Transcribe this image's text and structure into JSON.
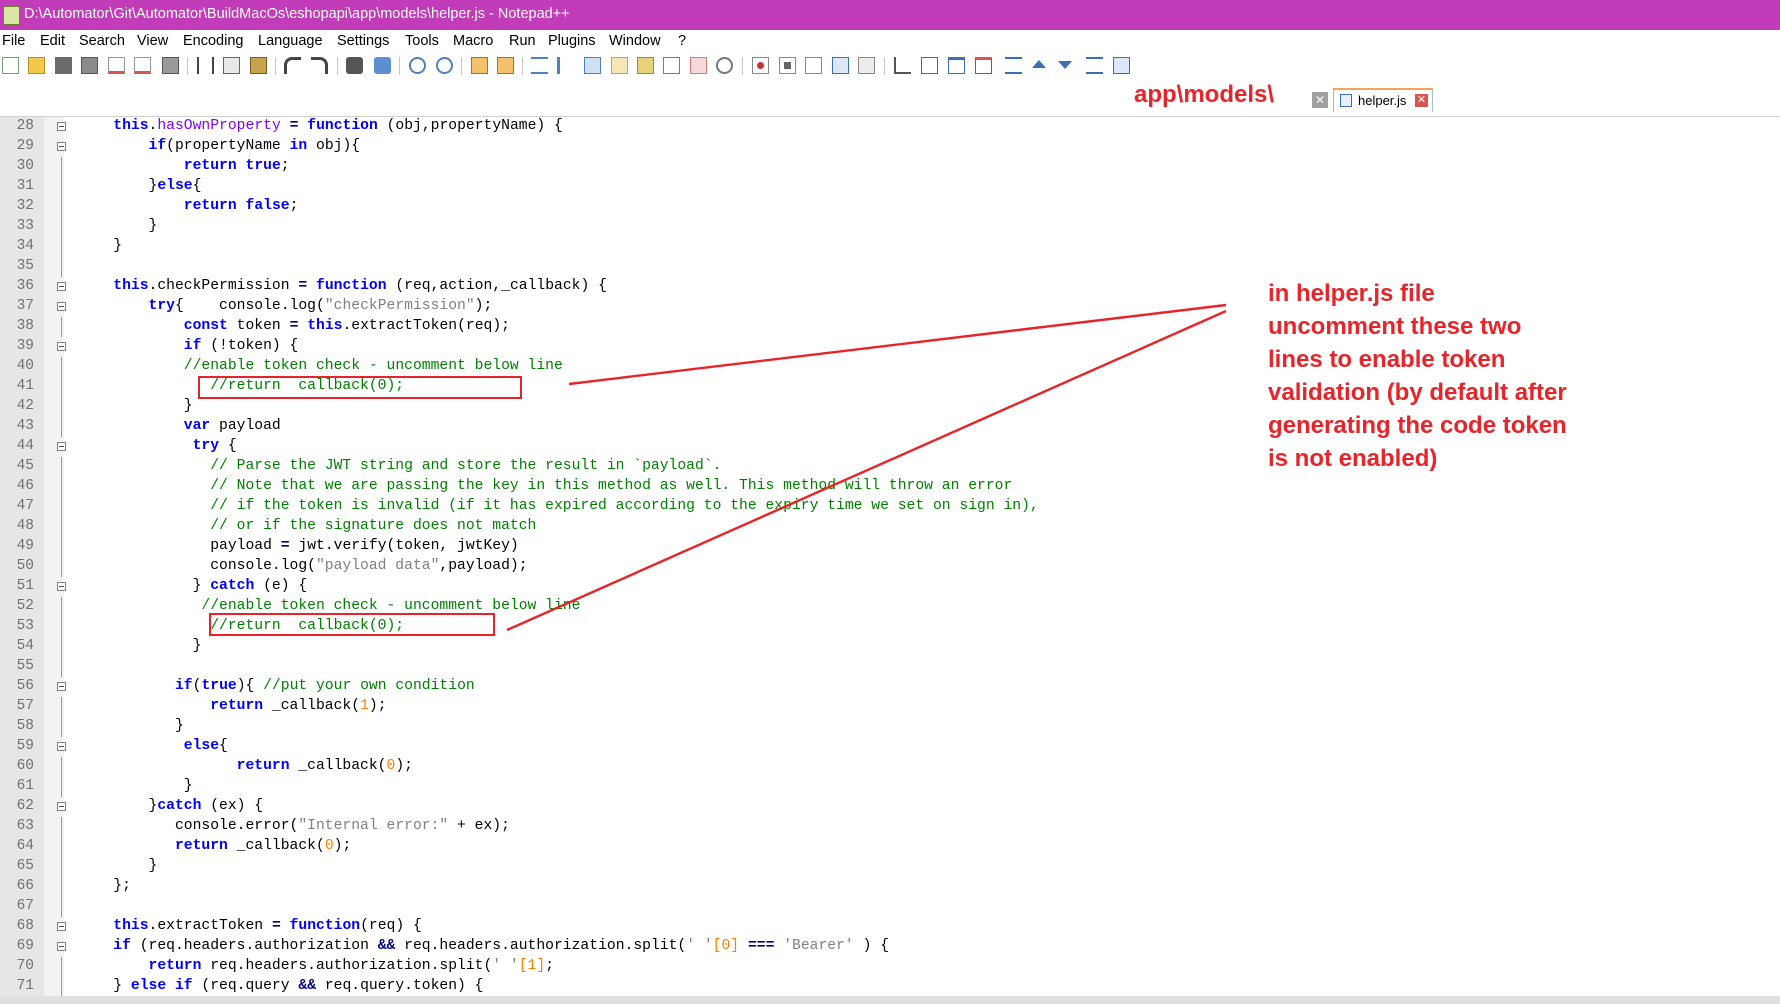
{
  "window": {
    "title": "D:\\Automator\\Git\\Automator\\BuildMacOs\\eshopapi\\app\\models\\helper.js - Notepad++"
  },
  "menu": {
    "items": [
      "File",
      "Edit",
      "Search",
      "View",
      "Encoding",
      "Language",
      "Settings",
      "Tools",
      "Macro",
      "Run",
      "Plugins",
      "Window",
      "?"
    ]
  },
  "toolbar": {
    "icons": [
      "new-file-icon",
      "open-file-icon",
      "save-icon",
      "save-all-icon",
      "close-icon",
      "close-all-icon",
      "print-icon",
      "cut-icon",
      "copy-icon",
      "paste-icon",
      "undo-icon",
      "redo-icon",
      "find-icon",
      "replace-icon",
      "zoom-in-icon",
      "zoom-out-icon",
      "sync-vertical-icon",
      "sync-horizontal-icon",
      "word-wrap-icon",
      "show-all-chars-icon",
      "indent-guide-icon",
      "udl-icon",
      "doc-map-icon",
      "function-list-icon",
      "folder-as-workspace-icon",
      "monitoring-icon",
      "record-macro-icon",
      "stop-record-icon",
      "play-macro-icon",
      "run-macro-multiple-icon",
      "save-macro-icon"
    ]
  },
  "tabs": {
    "active_label": "helper.js"
  },
  "annotations": {
    "path": "app\\models\\",
    "note": "in helper.js file uncomment these two lines to enable token validation (by default after generating the code token is not enabled)"
  },
  "colors": {
    "titlebar": "#c23bb8",
    "annotation_red": "#e8242a",
    "keyword": "#0000ff",
    "comment": "#008000",
    "string": "#808080",
    "number": "#ff8000",
    "property": "#8000ff"
  },
  "editor": {
    "lines": [
      {
        "n": "28",
        "segs": [
          [
            "",
            "    "
          ],
          [
            "kw",
            "this"
          ],
          [
            "",
            "."
          ],
          [
            "prop",
            "hasOwnProperty"
          ],
          [
            "",
            " "
          ],
          [
            "op",
            "="
          ],
          [
            "",
            " "
          ],
          [
            "kw",
            "function"
          ],
          [
            "",
            " (obj,propertyName) {"
          ]
        ]
      },
      {
        "n": "29",
        "segs": [
          [
            "",
            "        "
          ],
          [
            "kw",
            "if"
          ],
          [
            "",
            "(propertyName "
          ],
          [
            "kw",
            "in"
          ],
          [
            "",
            " obj){"
          ]
        ]
      },
      {
        "n": "30",
        "segs": [
          [
            "",
            "            "
          ],
          [
            "kw",
            "return"
          ],
          [
            "",
            " "
          ],
          [
            "kw",
            "true"
          ],
          [
            "",
            ";"
          ]
        ]
      },
      {
        "n": "31",
        "segs": [
          [
            "",
            "        }"
          ],
          [
            "kw",
            "else"
          ],
          [
            "",
            "{"
          ]
        ]
      },
      {
        "n": "32",
        "segs": [
          [
            "",
            "            "
          ],
          [
            "kw",
            "return"
          ],
          [
            "",
            " "
          ],
          [
            "kw",
            "false"
          ],
          [
            "",
            ";"
          ]
        ]
      },
      {
        "n": "33",
        "segs": [
          [
            "",
            "        }"
          ]
        ]
      },
      {
        "n": "34",
        "segs": [
          [
            "",
            "    }"
          ]
        ]
      },
      {
        "n": "35",
        "segs": []
      },
      {
        "n": "36",
        "segs": [
          [
            "",
            "    "
          ],
          [
            "kw",
            "this"
          ],
          [
            "",
            ".checkPermission "
          ],
          [
            "op",
            "="
          ],
          [
            "",
            " "
          ],
          [
            "kw",
            "function"
          ],
          [
            "",
            " (req,action,_callback) {"
          ]
        ]
      },
      {
        "n": "37",
        "segs": [
          [
            "",
            "        "
          ],
          [
            "kw",
            "try"
          ],
          [
            "",
            "{    console.log("
          ],
          [
            "str",
            "\"checkPermission\""
          ],
          [
            "",
            ");"
          ]
        ]
      },
      {
        "n": "38",
        "segs": [
          [
            "",
            "            "
          ],
          [
            "kw",
            "const"
          ],
          [
            "",
            " token "
          ],
          [
            "op",
            "="
          ],
          [
            "",
            " "
          ],
          [
            "kw",
            "this"
          ],
          [
            "",
            ".extractToken(req);"
          ]
        ]
      },
      {
        "n": "39",
        "segs": [
          [
            "",
            "            "
          ],
          [
            "kw",
            "if"
          ],
          [
            "",
            " (!token) {"
          ]
        ]
      },
      {
        "n": "40",
        "segs": [
          [
            "",
            "            "
          ],
          [
            "cmt",
            "//enable token check - uncomment below line"
          ]
        ]
      },
      {
        "n": "41",
        "segs": [
          [
            "",
            "               "
          ],
          [
            "cmt",
            "//return  callback(0);"
          ]
        ]
      },
      {
        "n": "42",
        "segs": [
          [
            "",
            "            }"
          ]
        ]
      },
      {
        "n": "43",
        "segs": [
          [
            "",
            "            "
          ],
          [
            "kw",
            "var"
          ],
          [
            "",
            " payload"
          ]
        ]
      },
      {
        "n": "44",
        "segs": [
          [
            "",
            "             "
          ],
          [
            "kw",
            "try"
          ],
          [
            "",
            " {"
          ]
        ]
      },
      {
        "n": "45",
        "segs": [
          [
            "",
            "               "
          ],
          [
            "cmt",
            "// Parse the JWT string and store the result in `payload`."
          ]
        ]
      },
      {
        "n": "46",
        "segs": [
          [
            "",
            "               "
          ],
          [
            "cmt",
            "// Note that we are passing the key in this method as well. This method will throw an error"
          ]
        ]
      },
      {
        "n": "47",
        "segs": [
          [
            "",
            "               "
          ],
          [
            "cmt",
            "// if the token is invalid (if it has expired according to the expiry time we set on sign in),"
          ]
        ]
      },
      {
        "n": "48",
        "segs": [
          [
            "",
            "               "
          ],
          [
            "cmt",
            "// or if the signature does not match"
          ]
        ]
      },
      {
        "n": "49",
        "segs": [
          [
            "",
            "               payload "
          ],
          [
            "op",
            "="
          ],
          [
            "",
            " jwt.verify(token, jwtKey)"
          ]
        ]
      },
      {
        "n": "50",
        "segs": [
          [
            "",
            "               console.log("
          ],
          [
            "str",
            "\"payload data\""
          ],
          [
            "",
            ",payload);"
          ]
        ]
      },
      {
        "n": "51",
        "segs": [
          [
            "",
            "             } "
          ],
          [
            "kw",
            "catch"
          ],
          [
            "",
            " (e) {"
          ]
        ]
      },
      {
        "n": "52",
        "segs": [
          [
            "",
            "              "
          ],
          [
            "cmt",
            "//enable token check - uncomment below line"
          ]
        ]
      },
      {
        "n": "53",
        "segs": [
          [
            "",
            "               "
          ],
          [
            "cmt",
            "//return  callback(0);"
          ]
        ]
      },
      {
        "n": "54",
        "segs": [
          [
            "",
            "             }"
          ]
        ]
      },
      {
        "n": "55",
        "segs": []
      },
      {
        "n": "56",
        "segs": [
          [
            "",
            "           "
          ],
          [
            "kw",
            "if"
          ],
          [
            "",
            "("
          ],
          [
            "kw",
            "true"
          ],
          [
            "",
            "){ "
          ],
          [
            "cmt",
            "//put your own condition"
          ]
        ]
      },
      {
        "n": "57",
        "segs": [
          [
            "",
            "               "
          ],
          [
            "kw",
            "return"
          ],
          [
            "",
            " _callback("
          ],
          [
            "num",
            "1"
          ],
          [
            "",
            ");"
          ]
        ]
      },
      {
        "n": "58",
        "segs": [
          [
            "",
            "           }"
          ]
        ]
      },
      {
        "n": "59",
        "segs": [
          [
            "",
            "            "
          ],
          [
            "kw",
            "else"
          ],
          [
            "",
            "{"
          ]
        ]
      },
      {
        "n": "60",
        "segs": [
          [
            "",
            "                  "
          ],
          [
            "kw",
            "return"
          ],
          [
            "",
            " _callback("
          ],
          [
            "num",
            "0"
          ],
          [
            "",
            ");"
          ]
        ]
      },
      {
        "n": "61",
        "segs": [
          [
            "",
            "            }"
          ]
        ]
      },
      {
        "n": "62",
        "segs": [
          [
            "",
            "        }"
          ],
          [
            "kw",
            "catch"
          ],
          [
            "",
            " (ex) {"
          ]
        ]
      },
      {
        "n": "63",
        "segs": [
          [
            "",
            "           console.error("
          ],
          [
            "str",
            "\"Internal error:\""
          ],
          [
            "",
            " + ex);"
          ]
        ]
      },
      {
        "n": "64",
        "segs": [
          [
            "",
            "           "
          ],
          [
            "kw",
            "return"
          ],
          [
            "",
            " _callback("
          ],
          [
            "num",
            "0"
          ],
          [
            "",
            ");"
          ]
        ]
      },
      {
        "n": "65",
        "segs": [
          [
            "",
            "        }"
          ]
        ]
      },
      {
        "n": "66",
        "segs": [
          [
            "",
            "    };"
          ]
        ]
      },
      {
        "n": "67",
        "segs": []
      },
      {
        "n": "68",
        "segs": [
          [
            "",
            "    "
          ],
          [
            "kw",
            "this"
          ],
          [
            "",
            ".extractToken "
          ],
          [
            "op",
            "="
          ],
          [
            "",
            " "
          ],
          [
            "kw",
            "function"
          ],
          [
            "",
            "(req) {"
          ]
        ]
      },
      {
        "n": "69",
        "segs": [
          [
            "",
            "    "
          ],
          [
            "kw",
            "if"
          ],
          [
            "",
            " (req.headers.authorization "
          ],
          [
            "op",
            "&&"
          ],
          [
            "",
            " req.headers.authorization.split("
          ],
          [
            "str",
            "' '"
          ],
          [
            ")"
          ],
          [
            "num",
            "[0]"
          ],
          [
            "",
            " "
          ],
          [
            "op",
            "==="
          ],
          [
            "",
            " "
          ],
          [
            "str",
            "'Bearer'"
          ],
          [
            "",
            " ) {"
          ]
        ]
      },
      {
        "n": "70",
        "segs": [
          [
            "",
            "        "
          ],
          [
            "kw",
            "return"
          ],
          [
            "",
            " req.headers.authorization.split("
          ],
          [
            "str",
            "' '"
          ],
          [
            ")"
          ],
          [
            "num",
            "[1]"
          ],
          [
            "",
            ";"
          ]
        ]
      },
      {
        "n": "71",
        "segs": [
          [
            "",
            "    } "
          ],
          [
            "kw",
            "else if"
          ],
          [
            "",
            " (req.query "
          ],
          [
            "op",
            "&&"
          ],
          [
            "",
            " req.query.token) {"
          ]
        ]
      }
    ]
  }
}
